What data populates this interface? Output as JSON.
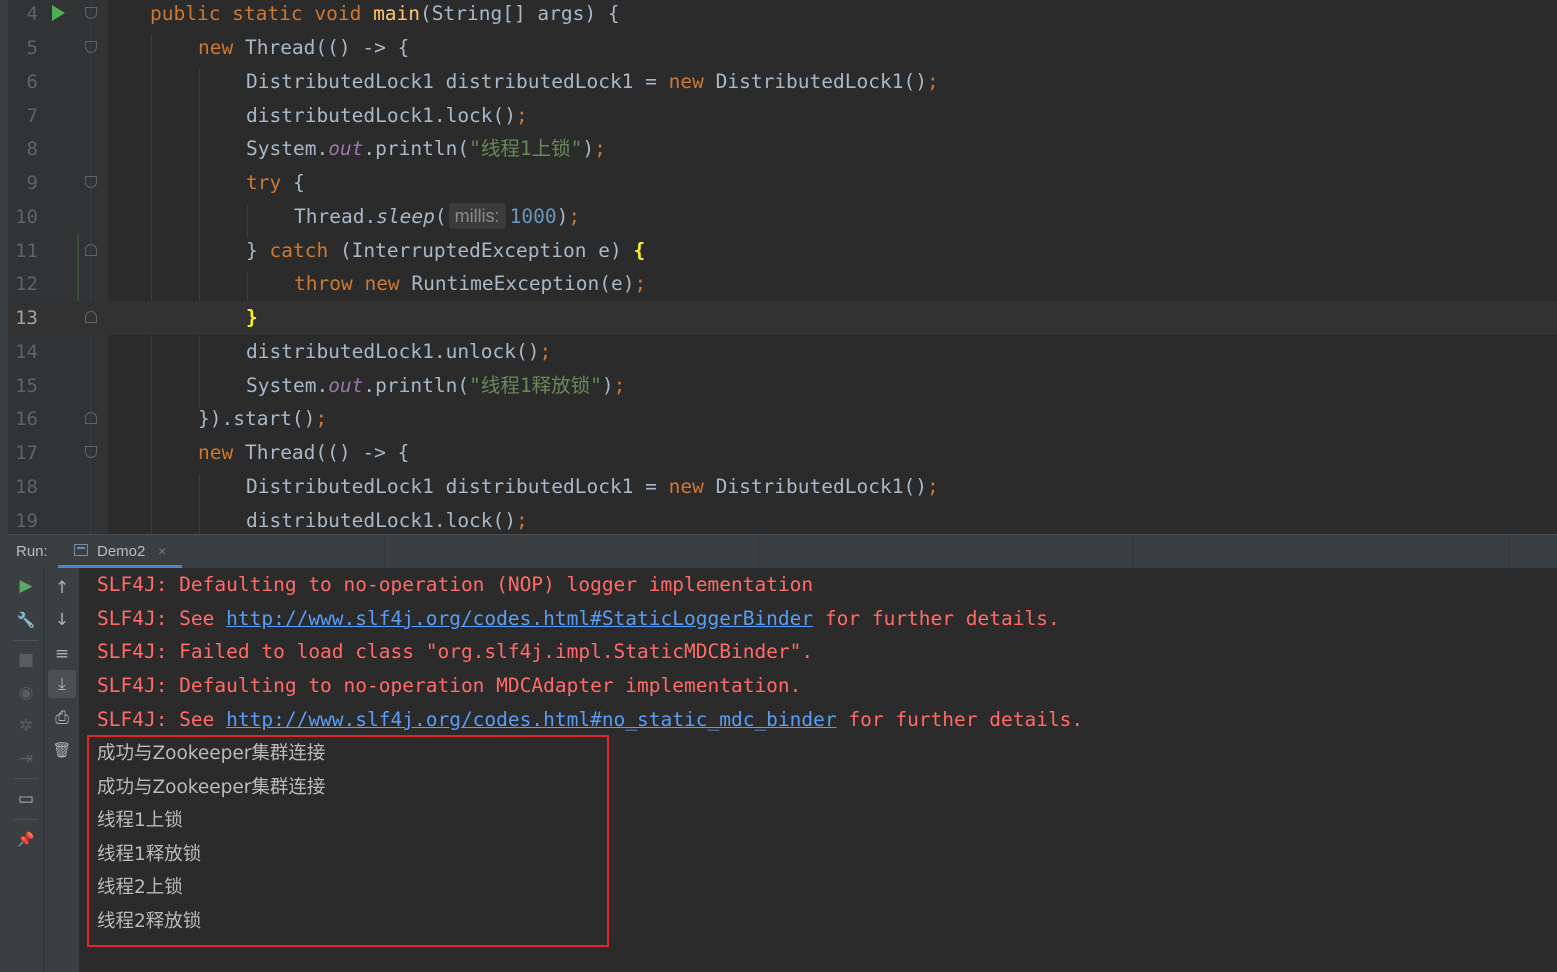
{
  "editor": {
    "line_numbers": [
      "4",
      "5",
      "6",
      "7",
      "8",
      "9",
      "10",
      "11",
      "12",
      "13",
      "14",
      "15",
      "16",
      "17",
      "18",
      "19"
    ],
    "lines": {
      "l4": {
        "kw1": "public static void ",
        "fn": "main",
        "rest": "(String[] args) {"
      },
      "l5": {
        "kw": "new ",
        "rest": "Thread(() -> {"
      },
      "l6": {
        "a": "DistributedLock1 distributedLock1 = ",
        "kw": "new ",
        "b": "DistributedLock1()",
        "semi": ";"
      },
      "l7": {
        "a": "distributedLock1.lock()",
        "semi": ";"
      },
      "l8": {
        "a": "System.",
        "fld": "out",
        "b": ".println(",
        "str": "\"线程1上锁\"",
        "c": ")",
        "semi": ";"
      },
      "l9": {
        "kw": "try ",
        "rest": "{"
      },
      "l10": {
        "a": "Thread.",
        "it": "sleep",
        "b": "(",
        "hint": "millis:",
        "num": "1000",
        "c": ")",
        "semi": ";"
      },
      "l11": {
        "a": "} ",
        "kw": "catch ",
        "b": "(InterruptedException e) ",
        "brace": "{"
      },
      "l12": {
        "kw1": "throw ",
        "kw2": "new ",
        "rest": "RuntimeException(e)",
        "semi": ";"
      },
      "l13": {
        "brace": "}"
      },
      "l14": {
        "a": "distributedLock1.unlock()",
        "semi": ";"
      },
      "l15": {
        "a": "System.",
        "fld": "out",
        "b": ".println(",
        "str": "\"线程1释放锁\"",
        "c": ")",
        "semi": ";"
      },
      "l16": {
        "a": "}).start()",
        "semi": ";"
      },
      "l17": {
        "kw": "new ",
        "rest": "Thread(() -> {"
      },
      "l18": {
        "a": "DistributedLock1 distributedLock1 = ",
        "kw": "new ",
        "b": "DistributedLock1()",
        "semi": ";"
      },
      "l19": {
        "a": "distributedLock1.lock()",
        "semi": ";"
      }
    }
  },
  "run_panel": {
    "label": "Run:",
    "tab": {
      "name": "Demo2",
      "close": "×"
    },
    "toolbar_left": [
      {
        "icon": "rerun-icon",
        "glyph": "▶"
      },
      {
        "icon": "wrench-icon",
        "glyph": "🔧"
      },
      {
        "icon": "stop-icon",
        "glyph": "■"
      },
      {
        "icon": "camera-icon",
        "glyph": "◉"
      },
      {
        "icon": "settings-icon",
        "glyph": "✲"
      },
      {
        "icon": "exit-icon",
        "glyph": "⇥"
      },
      {
        "icon": "layout-icon",
        "glyph": "▭"
      },
      {
        "icon": "pin-icon",
        "glyph": "📌"
      }
    ],
    "toolbar_right": [
      {
        "icon": "up-arrow-icon",
        "glyph": "↑"
      },
      {
        "icon": "down-arrow-icon",
        "glyph": "↓"
      },
      {
        "icon": "soft-wrap-icon",
        "glyph": "≡"
      },
      {
        "icon": "scroll-to-end-icon",
        "glyph": "⤓"
      },
      {
        "icon": "print-icon",
        "glyph": "⎙"
      },
      {
        "icon": "trash-icon",
        "glyph": "🗑"
      }
    ]
  },
  "console": {
    "slf4j": [
      {
        "pre": "SLF4J: Defaulting to no-operation (NOP) logger implementation"
      },
      {
        "pre": "SLF4J: See ",
        "link": "http://www.slf4j.org/codes.html#StaticLoggerBinder",
        "post": " for further details."
      },
      {
        "pre": "SLF4J: Failed to load class \"org.slf4j.impl.StaticMDCBinder\"."
      },
      {
        "pre": "SLF4J: Defaulting to no-operation MDCAdapter implementation."
      },
      {
        "pre": "SLF4J: See ",
        "link": "http://www.slf4j.org/codes.html#no_static_mdc_binder",
        "post": " for further details."
      }
    ],
    "output": [
      "成功与Zookeeper集群连接",
      "成功与Zookeeper集群连接",
      "线程1上锁",
      "线程1释放锁",
      "线程2上锁",
      "线程2释放锁"
    ]
  }
}
